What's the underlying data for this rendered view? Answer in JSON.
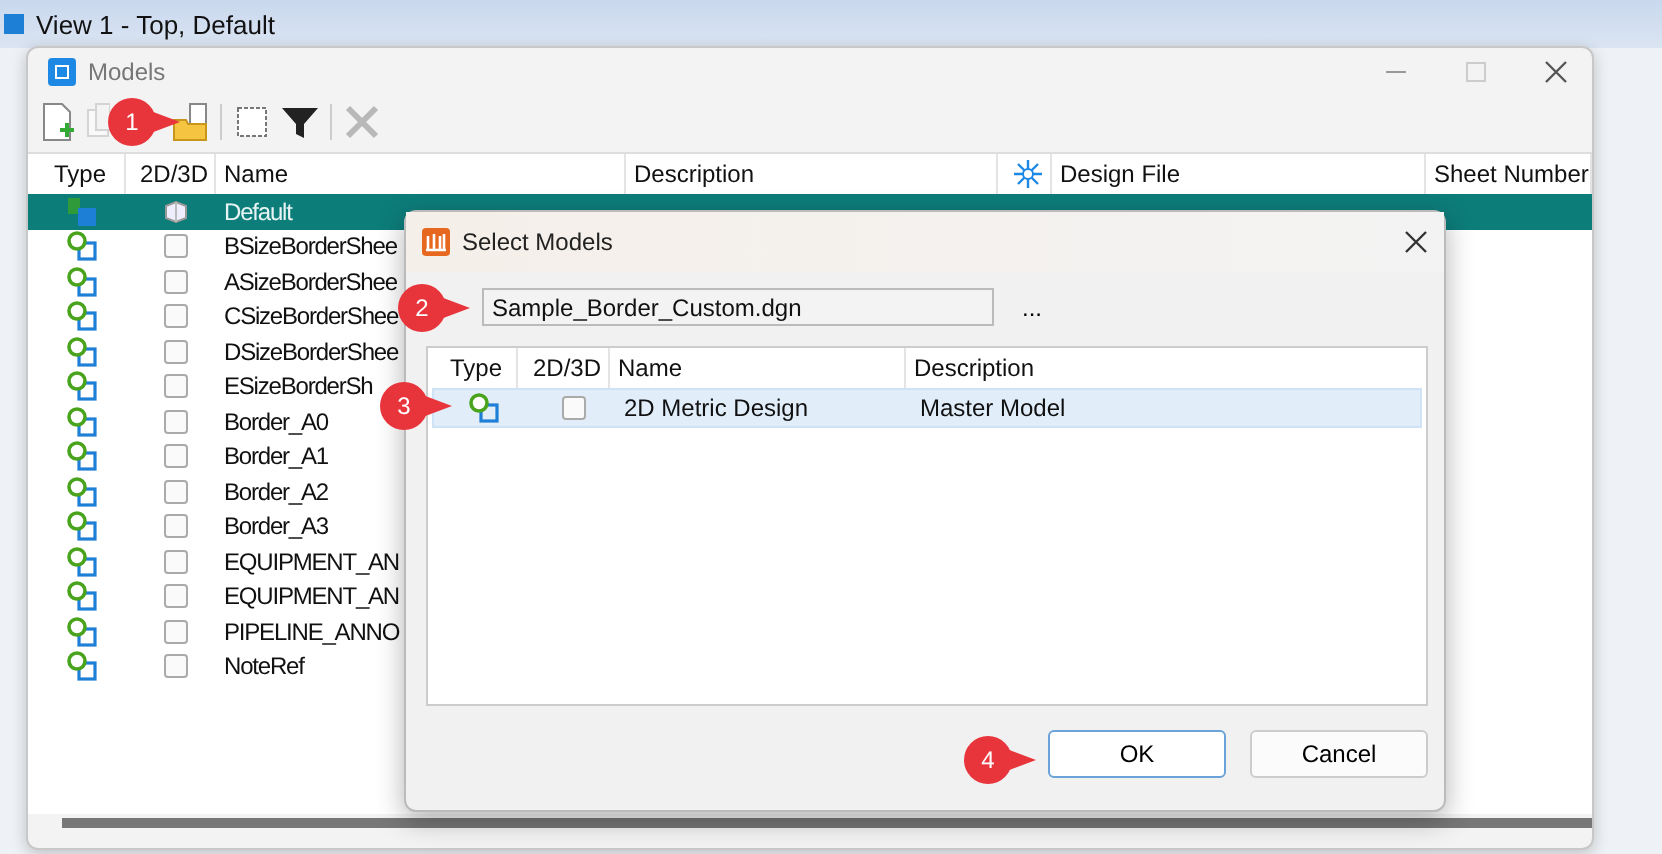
{
  "app_bar": {
    "title": "View 1 - Top, Default"
  },
  "models_window": {
    "title": "Models",
    "toolbar": [
      {
        "kind": "new",
        "disabled": false
      },
      {
        "kind": "copy",
        "disabled": true
      },
      {
        "kind": "attach",
        "disabled": false
      },
      {
        "kind": "select",
        "disabled": false
      },
      {
        "kind": "filter",
        "disabled": false
      },
      {
        "kind": "delete",
        "disabled": true
      }
    ],
    "columns": [
      "Type",
      "2D/3D",
      "Name",
      "Description",
      "",
      "Design File",
      "Sheet Number"
    ],
    "rows": [
      {
        "kind": "solid",
        "name": "Default",
        "selected": true
      },
      {
        "kind": "flat",
        "name": "BSizeBorderShee",
        "selected": false
      },
      {
        "kind": "flat",
        "name": "ASizeBorderShee",
        "selected": false
      },
      {
        "kind": "flat",
        "name": "CSizeBorderShee",
        "selected": false
      },
      {
        "kind": "flat",
        "name": "DSizeBorderShee",
        "selected": false
      },
      {
        "kind": "flat",
        "name": "ESizeBorderSh",
        "selected": false
      },
      {
        "kind": "flat",
        "name": "Border_A0",
        "selected": false
      },
      {
        "kind": "flat",
        "name": "Border_A1",
        "selected": false
      },
      {
        "kind": "flat",
        "name": "Border_A2",
        "selected": false
      },
      {
        "kind": "flat",
        "name": "Border_A3",
        "selected": false
      },
      {
        "kind": "flat",
        "name": "EQUIPMENT_AN",
        "selected": false
      },
      {
        "kind": "flat",
        "name": "EQUIPMENT_AN",
        "selected": false
      },
      {
        "kind": "flat",
        "name": "PIPELINE_ANNO",
        "selected": false
      },
      {
        "kind": "flat",
        "name": "NoteRef",
        "selected": false
      }
    ]
  },
  "select_dialog": {
    "title": "Select Models",
    "file": "Sample_Border_Custom.dgn",
    "browse": "...",
    "columns": [
      "Type",
      "2D/3D",
      "Name",
      "Description"
    ],
    "rows": [
      {
        "kind": "flat",
        "name": "2D Metric Design",
        "description": "Master Model",
        "selected": true
      }
    ],
    "buttons": [
      {
        "label": "OK",
        "default": true
      },
      {
        "label": "Cancel",
        "default": false
      }
    ]
  },
  "callouts": [
    "1",
    "2",
    "3",
    "4"
  ]
}
